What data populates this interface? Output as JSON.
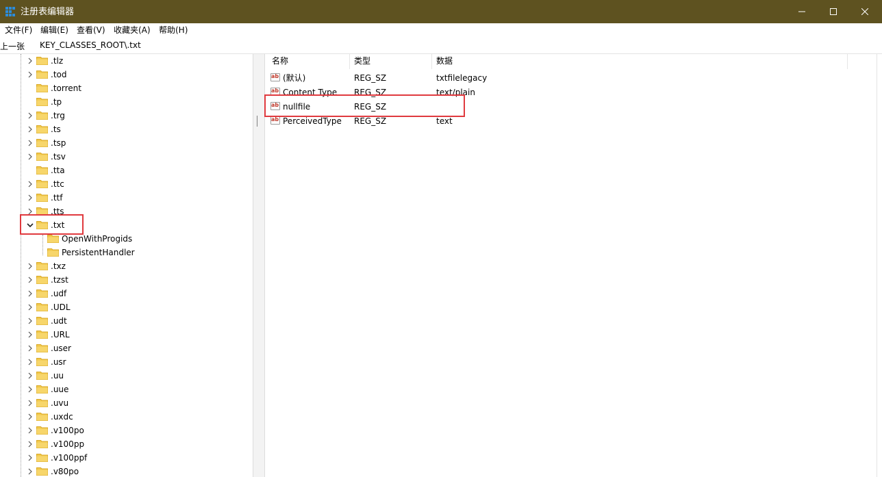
{
  "window": {
    "title": "注册表编辑器",
    "titlebar_color": "#5e5220",
    "controls": [
      "minimize-icon",
      "maximize-icon",
      "close-icon"
    ]
  },
  "menu": {
    "items": [
      "文件(F)",
      "编辑(E)",
      "查看(V)",
      "收藏夹(A)",
      "帮助(H)"
    ]
  },
  "address": {
    "back_label": "上一张",
    "path": "KEY_CLASSES_ROOT\\.txt"
  },
  "tree": {
    "items": [
      {
        "label": ".tlz",
        "expandable": true
      },
      {
        "label": ".tod",
        "expandable": true
      },
      {
        "label": ".torrent",
        "expandable": false
      },
      {
        "label": ".tp",
        "expandable": false
      },
      {
        "label": ".trg",
        "expandable": true
      },
      {
        "label": ".ts",
        "expandable": true
      },
      {
        "label": ".tsp",
        "expandable": true
      },
      {
        "label": ".tsv",
        "expandable": true
      },
      {
        "label": ".tta",
        "expandable": false
      },
      {
        "label": ".ttc",
        "expandable": true
      },
      {
        "label": ".ttf",
        "expandable": true
      },
      {
        "label": ".tts",
        "expandable": true
      },
      {
        "label": ".txt",
        "expandable": true,
        "expanded": true,
        "highlighted": true
      },
      {
        "label": "OpenWithProgids",
        "child": true
      },
      {
        "label": "PersistentHandler",
        "child": true
      },
      {
        "label": ".txz",
        "expandable": true
      },
      {
        "label": ".tzst",
        "expandable": true
      },
      {
        "label": ".udf",
        "expandable": true
      },
      {
        "label": ".UDL",
        "expandable": true
      },
      {
        "label": ".udt",
        "expandable": true
      },
      {
        "label": ".URL",
        "expandable": true
      },
      {
        "label": ".user",
        "expandable": true
      },
      {
        "label": ".usr",
        "expandable": true
      },
      {
        "label": ".uu",
        "expandable": true
      },
      {
        "label": ".uue",
        "expandable": true
      },
      {
        "label": ".uvu",
        "expandable": true
      },
      {
        "label": ".uxdc",
        "expandable": true
      },
      {
        "label": ".v100po",
        "expandable": true
      },
      {
        "label": ".v100pp",
        "expandable": true
      },
      {
        "label": ".v100ppf",
        "expandable": true
      },
      {
        "label": ".v80po",
        "expandable": true
      }
    ]
  },
  "values": {
    "headers": {
      "name": "名称",
      "type": "类型",
      "data": "数据"
    },
    "rows": [
      {
        "name": "(默认)",
        "type": "REG_SZ",
        "data": "txtfilelegacy"
      },
      {
        "name": "Content Type",
        "type": "REG_SZ",
        "data": "text/plain"
      },
      {
        "name": "nullfile",
        "type": "REG_SZ",
        "data": "",
        "highlighted": true
      },
      {
        "name": "PerceivedType",
        "type": "REG_SZ",
        "data": "text"
      }
    ]
  },
  "highlight_color": "#e0393e",
  "folder_color": "#f2c94c"
}
